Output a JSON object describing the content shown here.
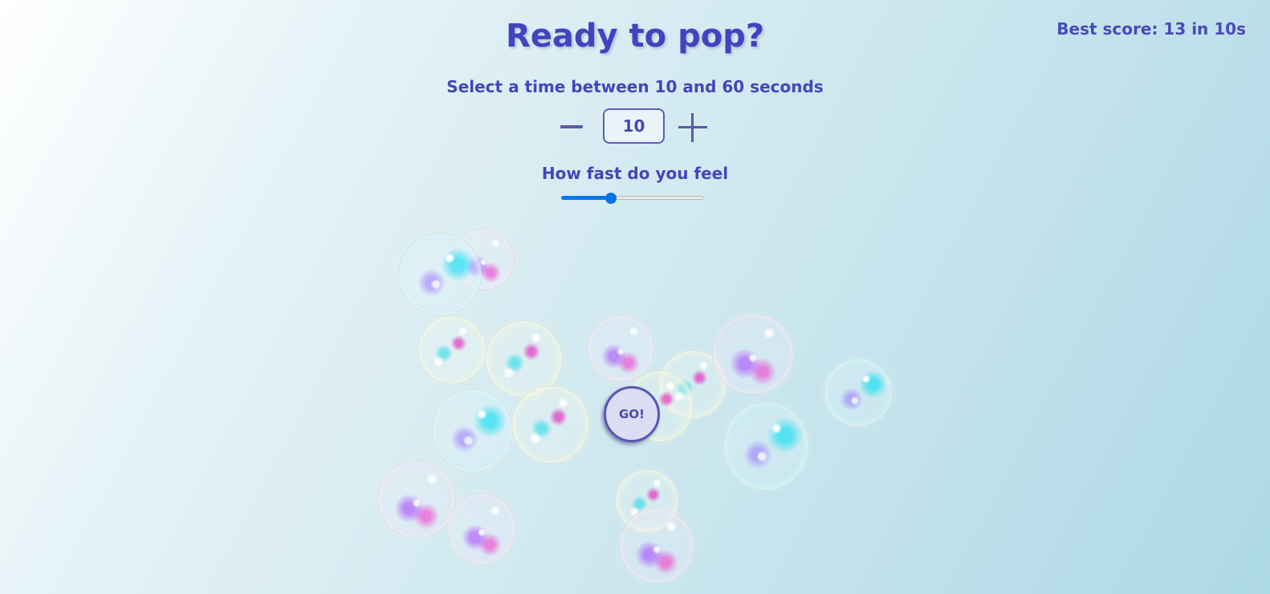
{
  "header": {
    "best_score": "Best score: 13 in 10s",
    "title": "Ready to pop?"
  },
  "time_selector": {
    "prompt": "Select a time between 10 and 60 seconds",
    "value": "10",
    "minus_icon": "minus-icon",
    "plus_icon": "plus-icon"
  },
  "speed": {
    "label": "How fast do you feel",
    "slider_fraction": 0.35,
    "accent_color": "#0b76e8"
  },
  "start": {
    "go_label": "GO!"
  },
  "colors": {
    "text": "#4545bc",
    "button_bg": "#dcdcf2",
    "button_border": "#5858b2"
  }
}
